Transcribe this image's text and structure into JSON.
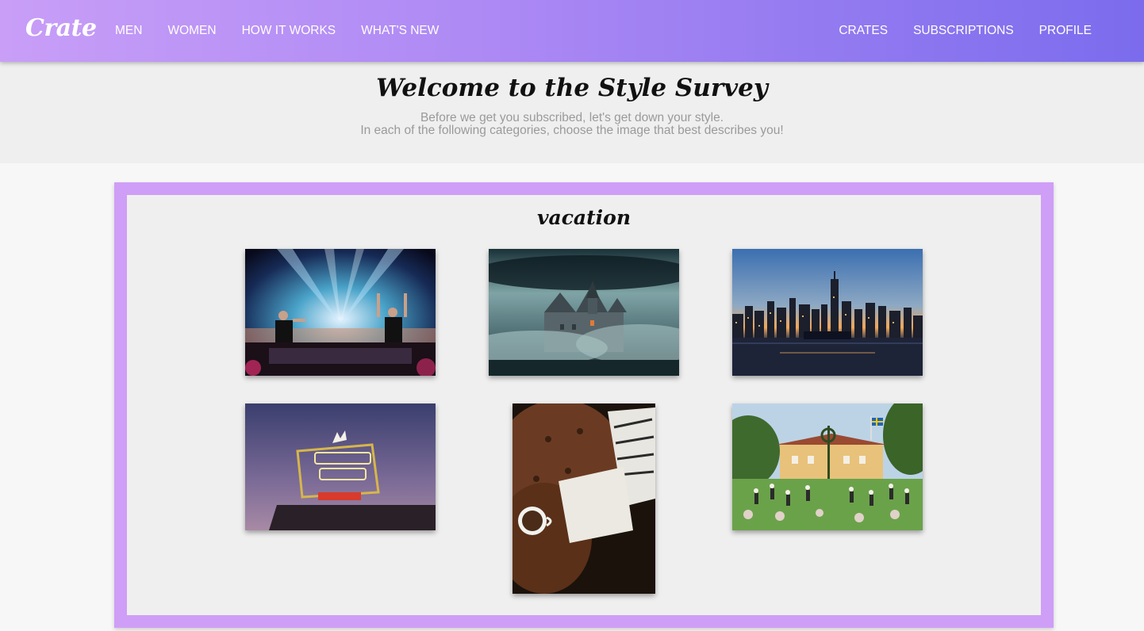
{
  "navbar": {
    "brand": "Crate",
    "left_links": [
      "MEN",
      "WOMEN",
      "HOW IT WORKS",
      "WHAT'S NEW"
    ],
    "right_links": [
      "CRATES",
      "SUBSCRIPTIONS",
      "PROFILE"
    ],
    "gradient_colors": [
      "#c89ef7",
      "#7b6ced"
    ]
  },
  "hero": {
    "title": "Welcome to the Style Survey",
    "subtitle_line1": "Before we get you subscribed, let's get down your style.",
    "subtitle_line2": "In each of the following categories, choose the image that best describes you!"
  },
  "survey": {
    "border_color": "#cf9ef7",
    "category": "vacation",
    "options": [
      {
        "name": "concert-festival-image"
      },
      {
        "name": "misty-castle-image"
      },
      {
        "name": "city-skyline-sunset-image"
      },
      {
        "name": "portland-oregon-sign-image"
      },
      {
        "name": "leather-chair-coffee-image"
      },
      {
        "name": "midsummer-festival-image"
      }
    ]
  }
}
